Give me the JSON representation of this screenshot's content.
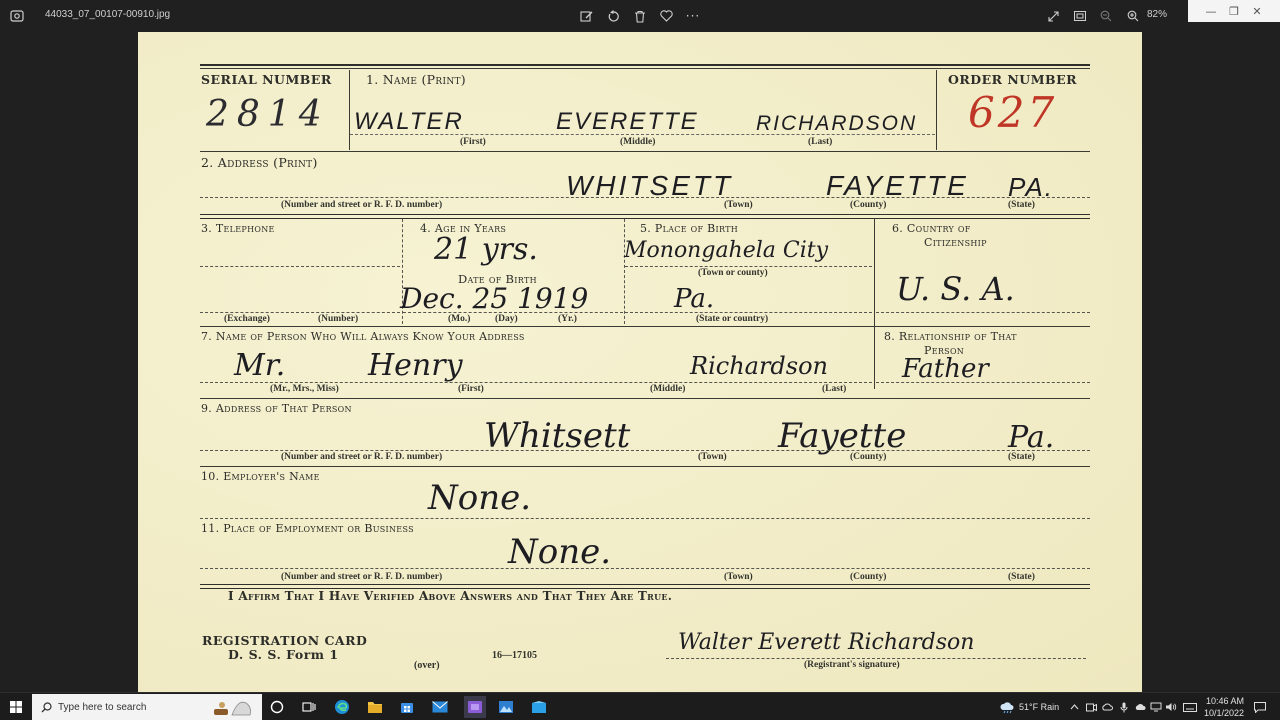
{
  "window": {
    "file_name": "44033_07_00107-00910.jpg",
    "zoom": "82%",
    "controls": {
      "minimize": "—",
      "restore": "❐",
      "close": "✕"
    }
  },
  "toolbar_icons": [
    "edit-icon",
    "rotate-icon",
    "delete-icon",
    "favorite-icon",
    "more-icon"
  ],
  "right_toolbar_icons": [
    "fullscreen-icon",
    "filmstrip-icon",
    "zoom-out-icon",
    "zoom-in-icon"
  ],
  "card": {
    "serial_number_label": "SERIAL NUMBER",
    "serial_number": "2814",
    "name_label": "1. Name (Print)",
    "first_name": "WALTER",
    "middle_name": "EVERETTE",
    "last_name": "RICHARDSON",
    "first_sub": "(First)",
    "middle_sub": "(Middle)",
    "last_sub": "(Last)",
    "order_number_label": "ORDER NUMBER",
    "order_number": "627",
    "address_label": "2. Address (Print)",
    "address_town": "WHITSETT",
    "address_county": "FAYETTE",
    "address_state": "PA.",
    "street_sub": "(Number and street or R. F. D. number)",
    "town_sub": "(Town)",
    "county_sub": "(County)",
    "state_sub": "(State)",
    "telephone_label": "3. Telephone",
    "exchange_sub": "(Exchange)",
    "number_sub": "(Number)",
    "age_label": "4. Age in Years",
    "age": "21 yrs.",
    "dob_label": "Date of Birth",
    "dob": "Dec. 25 1919",
    "mo_sub": "(Mo.)",
    "day_sub": "(Day)",
    "yr_sub": "(Yr.)",
    "pob_label": "5. Place of Birth",
    "pob_town": "Monongahela City",
    "town_or_county_sub": "(Town or county)",
    "pob_state": "Pa.",
    "state_or_country_sub": "(State or country)",
    "citizenship_label_1": "6. Country of",
    "citizenship_label_2": "Citizenship",
    "citizenship": "U. S. A.",
    "contact_label": "7. Name of Person Who Will Always Know Your Address",
    "contact_title": "Mr.",
    "contact_first": "Henry",
    "contact_last": "Richardson",
    "title_sub": "(Mr., Mrs., Miss)",
    "relationship_label_1": "8. Relationship of That",
    "relationship_label_2": "Person",
    "relationship": "Father",
    "contact_address_label": "9. Address of That Person",
    "contact_town": "Whitsett",
    "contact_county": "Fayette",
    "contact_state": "Pa.",
    "employer_label": "10. Employer's Name",
    "employer": "None.",
    "employment_place_label": "11. Place of Employment or Business",
    "employment_place": "None.",
    "affirm_text": "I Affirm That I Have Verified Above Answers and That They Are True.",
    "reg_card_line1": "REGISTRATION CARD",
    "reg_card_line2": "D. S. S. Form 1",
    "over_text": "(over)",
    "form_number": "16—17105",
    "signature": "Walter Everett Richardson",
    "signature_sub": "(Registrant's signature)"
  },
  "taskbar": {
    "search_placeholder": "Type here to search",
    "weather": "51°F  Rain",
    "time": "10:46 AM",
    "date": "10/1/2022"
  }
}
